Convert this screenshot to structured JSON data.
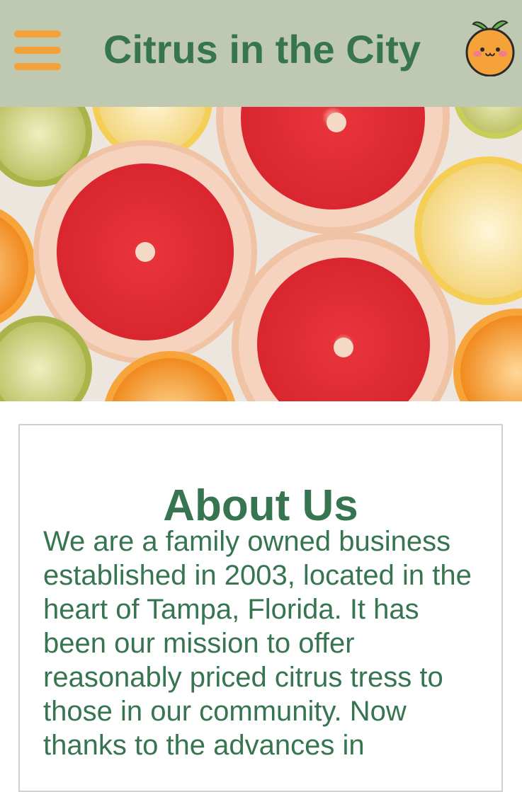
{
  "header": {
    "title": "Citrus in the City",
    "menu_icon": "hamburger-menu-icon",
    "logo_icon": "smiling-orange-logo-icon"
  },
  "hero": {
    "image": "sliced-citrus-fruits-photo"
  },
  "about": {
    "title": "About Us",
    "body": "We are a family owned business established in 2003, located in the heart of Tampa, Florida. It has been our mission to offer reasonably priced citrus tress to those in our community. Now thanks to the advances in"
  },
  "colors": {
    "header_bg": "#bfc9b1",
    "brand_green": "#367550",
    "menu_orange": "#f2a238"
  }
}
